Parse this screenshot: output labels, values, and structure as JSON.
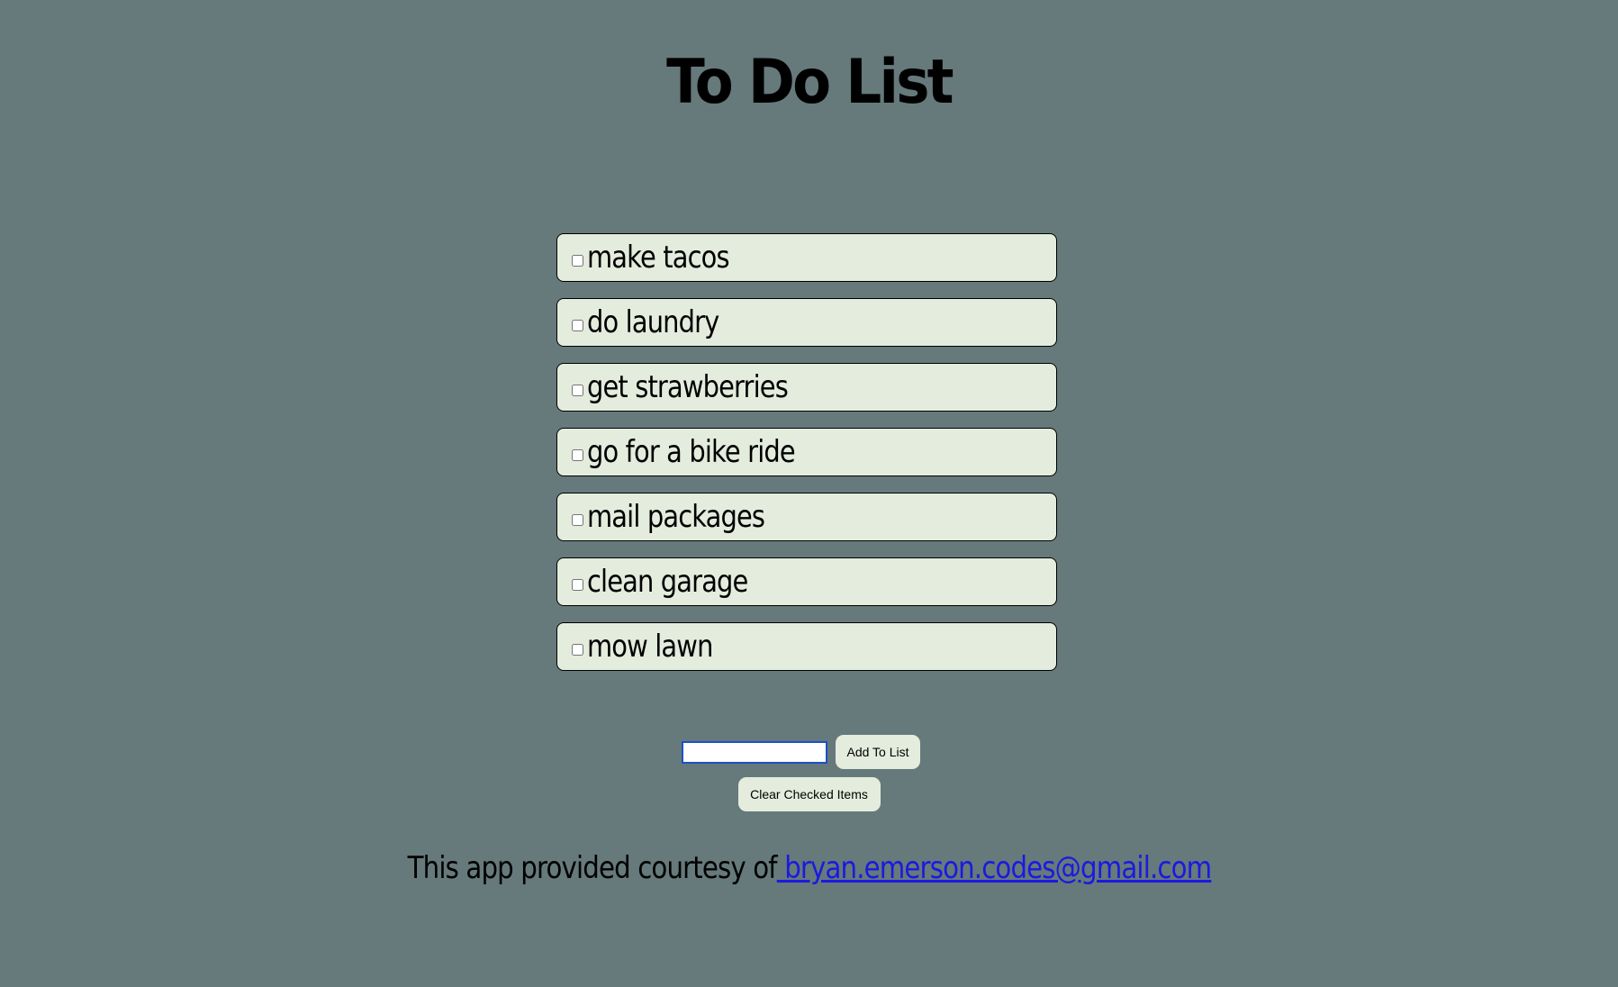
{
  "header": {
    "title": "To Do List"
  },
  "todo_items": [
    {
      "label": "make tacos",
      "checked": false
    },
    {
      "label": "do laundry",
      "checked": false
    },
    {
      "label": "get strawberries",
      "checked": false
    },
    {
      "label": "go for a bike ride",
      "checked": false
    },
    {
      "label": "mail packages",
      "checked": false
    },
    {
      "label": "clean garage",
      "checked": false
    },
    {
      "label": "mow lawn",
      "checked": false
    }
  ],
  "add_form": {
    "input_value": "",
    "add_button_label": "Add To List",
    "clear_button_label": "Clear Checked Items"
  },
  "footer": {
    "text": "This app provided courtesy of",
    "link_text": " bryan.emerson.codes@gmail.com"
  },
  "colors": {
    "background": "#66797b",
    "item_background": "#e4ecdd",
    "link": "#1a1ae0",
    "input_focus_border": "#1b4fc9"
  }
}
